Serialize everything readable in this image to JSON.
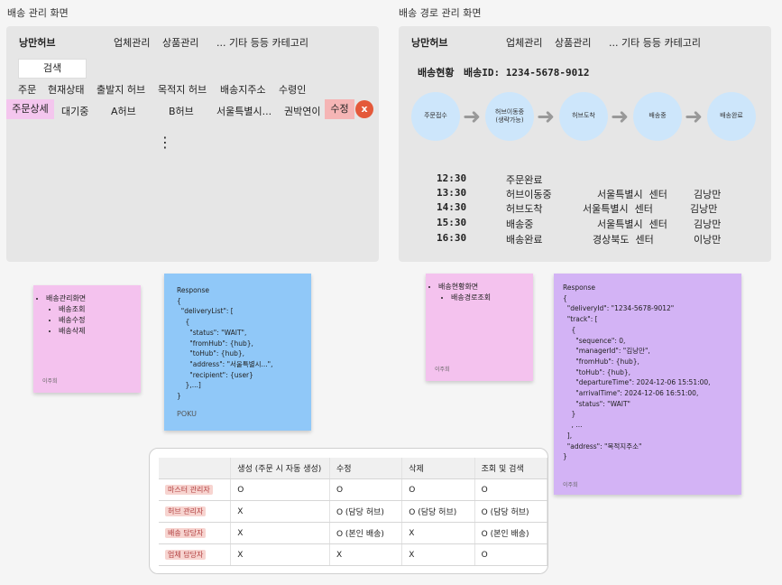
{
  "left_frame": {
    "title": "배송 관리 화면",
    "hub_name": "낭만허브",
    "menu": [
      "업체관리",
      "상품관리",
      "... 기타 등등 카테고리"
    ],
    "search_label": "검색",
    "columns": [
      "주문",
      "현재상태",
      "출발지 허브",
      "목적지 허브",
      "배송지주소",
      "수령인"
    ],
    "row": {
      "detail": "주문상세",
      "status": "대기중",
      "from": "A허브",
      "to": "B허브",
      "address": "서울특별시...",
      "recipient": "권박연이",
      "edit": "수정",
      "delete": "x"
    },
    "more": "⋮"
  },
  "right_frame": {
    "title": "배송 경로 관리 화면",
    "hub_name": "낭만허브",
    "menu": [
      "업체관리",
      "상품관리",
      "... 기타 등등 카테고리"
    ],
    "status_label": "배송현황",
    "delivery_id": "배송ID: 1234-5678-9012",
    "steps": [
      "주문접수",
      "허브이동중\n(생략가능)",
      "허브도착",
      "배송중",
      "배송완료"
    ],
    "timeline": [
      {
        "time": "12:30",
        "status": "주문완료",
        "center": "",
        "manager": ""
      },
      {
        "time": "13:30",
        "status": "허브이동중",
        "center": "서울특별시  센터",
        "manager": "김낭만"
      },
      {
        "time": "14:30",
        "status": "허브도착",
        "center": "서울특별시  센터",
        "manager": "김낭만"
      },
      {
        "time": "15:30",
        "status": "배송중",
        "center": "서울특별시  센터",
        "manager": "김낭만"
      },
      {
        "time": "16:30",
        "status": "배송완료",
        "center": "경상북도  센터",
        "manager": "이낭만"
      }
    ]
  },
  "note_left": {
    "items": [
      "배송관리화면"
    ],
    "subitems": [
      "배송조회",
      "배송수정",
      "배송삭제"
    ],
    "author": "이주희",
    "color": "#f4c2ee"
  },
  "response_left": {
    "text": "Response\n{\n  \"deliveryList\": [\n    {\n      \"status\": \"WAIT\",\n      \"fromHub\": {hub},\n      \"toHub\": {hub},\n      \"address\": \"서울특별시...\",\n      \"recipient\": {user}\n    },...]\n}",
    "author": "POKU",
    "color": "#90c8f8"
  },
  "note_right": {
    "items": [
      "배송현황화면"
    ],
    "subitems": [
      "배송경로조회"
    ],
    "author": "이주희",
    "color": "#f4c2ee"
  },
  "response_right": {
    "text": "Response\n{\n  \"deliveryId\": \"1234-5678-9012\"\n  \"track\": [\n    {\n      \"sequence\": 0,\n      \"managerId\": \"김낭만\",\n      \"fromHub\": {hub},\n      \"toHub\": {hub},\n      \"departureTime\": 2024-12-06 15:51:00,\n      \"arrivalTime\": 2024-12-06 16:51:00,\n      \"status\": \"WAIT\"\n    }\n    , ...\n  ],\n  \"address\": \"목적지주소\"\n}",
    "author": "이주희",
    "color": "#d3b3f5"
  },
  "permissions": {
    "headers": [
      "",
      "생성 (주문 시 자동 생성)",
      "수정",
      "삭제",
      "조회 및 검색"
    ],
    "rows": [
      {
        "role": "마스터 관리자",
        "cells": [
          "O",
          "O",
          "O",
          "O"
        ]
      },
      {
        "role": "허브 관리자",
        "cells": [
          "X",
          "O (담당 허브)",
          "O (담당 허브)",
          "O (담당 허브)"
        ]
      },
      {
        "role": "배송 담당자",
        "cells": [
          "X",
          "O (본인 배송)",
          "X",
          "O (본인 배송)"
        ]
      },
      {
        "role": "업체 담당자",
        "cells": [
          "X",
          "X",
          "X",
          "O"
        ]
      }
    ]
  }
}
